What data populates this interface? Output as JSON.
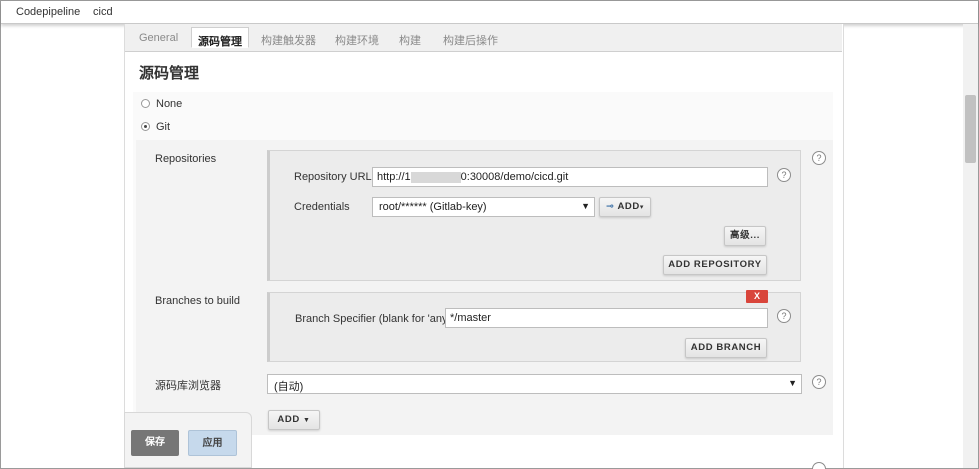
{
  "breadcrumb": [
    "Codepipeline",
    "cicd"
  ],
  "tabs": [
    {
      "label": "General",
      "active": false
    },
    {
      "label": "源码管理",
      "active": true
    },
    {
      "label": "构建触发器",
      "active": false
    },
    {
      "label": "构建环境",
      "active": false
    },
    {
      "label": "构建",
      "active": false
    },
    {
      "label": "构建后操作",
      "active": false
    }
  ],
  "section_title": "源码管理",
  "scm": {
    "options": [
      {
        "label": "None",
        "selected": false
      },
      {
        "label": "Git",
        "selected": true
      }
    ],
    "repositories_label": "Repositories",
    "repository_url_label": "Repository URL",
    "repository_url_prefix": "http://1",
    "repository_url_suffix": "0:30008/demo/cicd.git",
    "credentials_label": "Credentials",
    "credentials_value": "root/****** (Gitlab-key)",
    "add_credentials_label": "ADD",
    "advanced_label": "高级...",
    "add_repository_label": "ADD REPOSITORY",
    "branches_label": "Branches to build",
    "remove_branch_label": "X",
    "branch_specifier_label": "Branch Specifier (blank for 'any')",
    "branch_specifier_value": "*/master",
    "add_branch_label": "ADD BRANCH",
    "browser_label": "源码库浏览器",
    "browser_value": "(自动)",
    "add_label": "ADD"
  },
  "footer": {
    "save_label": "保存",
    "apply_label": "应用"
  },
  "help_glyph": "?",
  "colors": {
    "remove_button": "#d9453b",
    "save_button": "#767676",
    "apply_button": "#c6d9ec"
  }
}
